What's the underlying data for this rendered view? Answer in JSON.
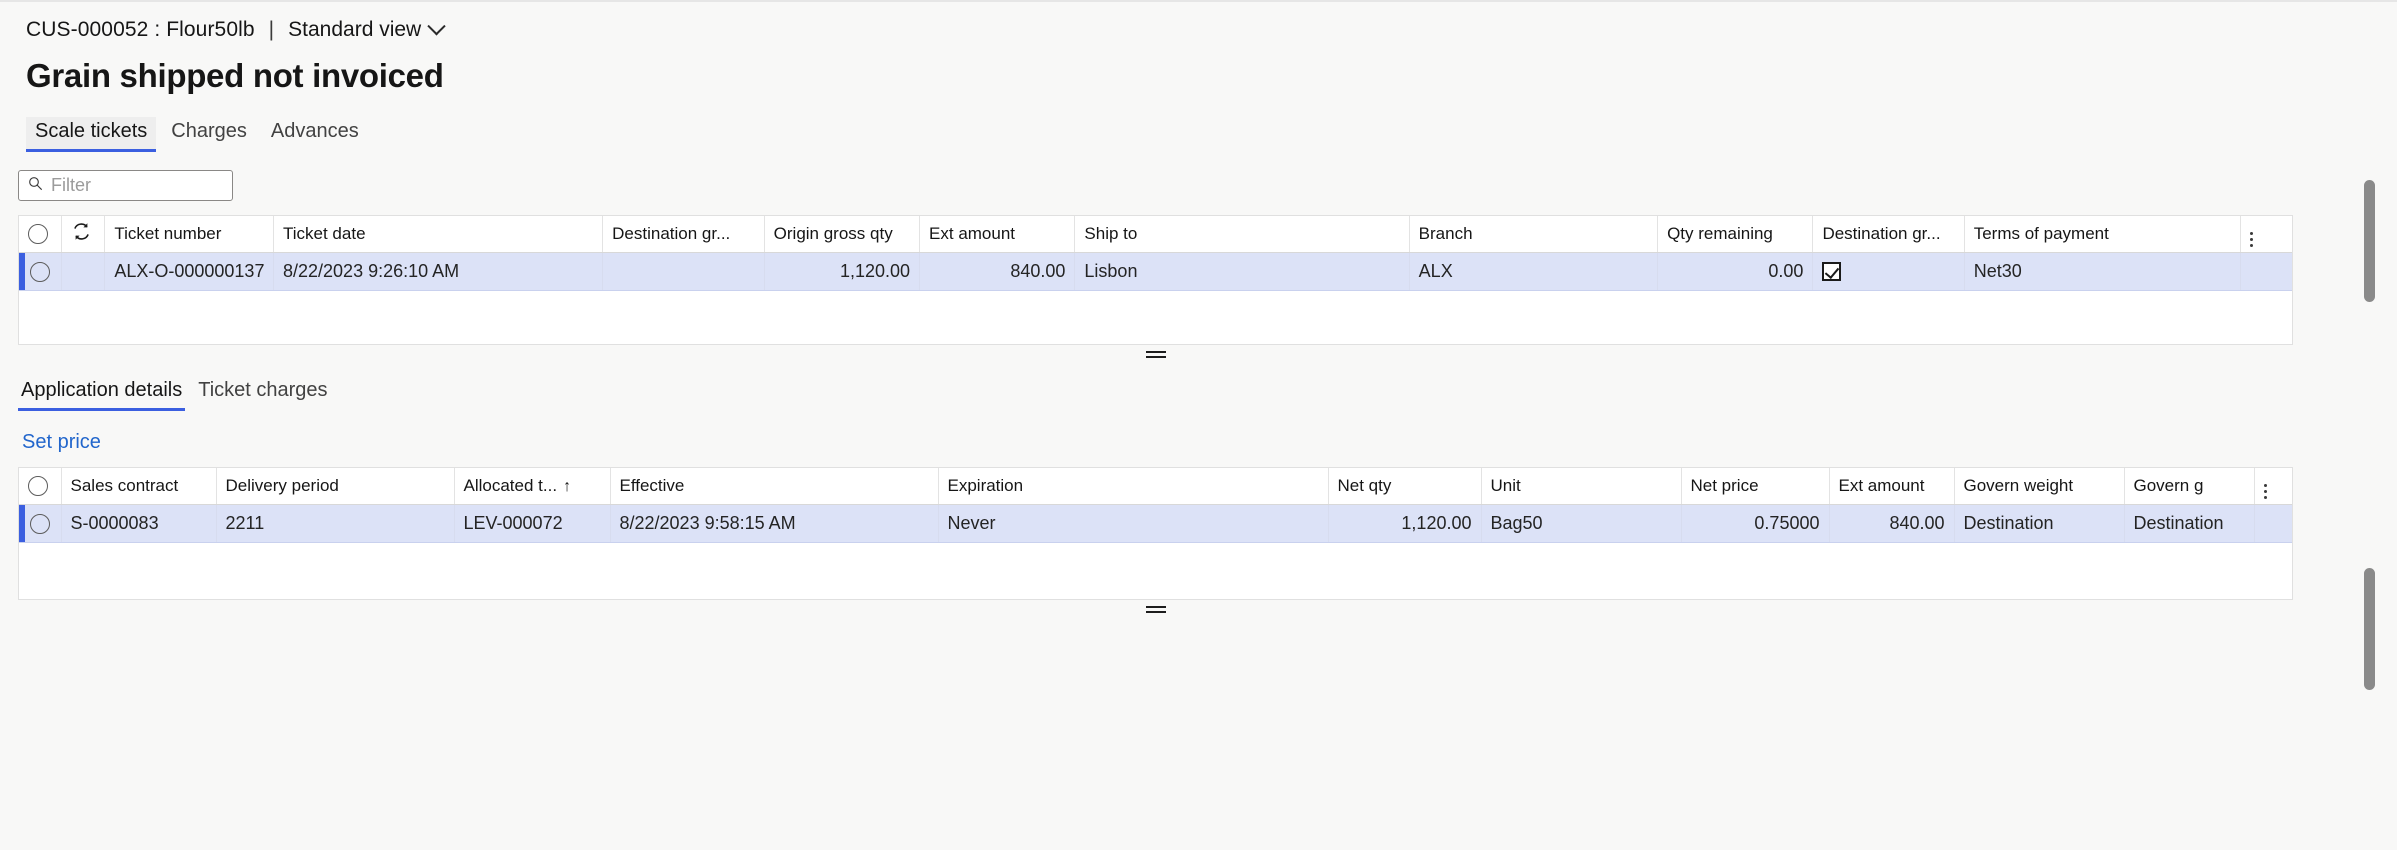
{
  "header": {
    "breadcrumb_record": "CUS-000052 : Flour50lb",
    "breadcrumb_separator": "|",
    "view_name": "Standard view",
    "page_title": "Grain shipped not invoiced"
  },
  "primary_tabs": [
    {
      "label": "Scale tickets",
      "active": true
    },
    {
      "label": "Charges",
      "active": false
    },
    {
      "label": "Advances",
      "active": false
    }
  ],
  "filter": {
    "placeholder": "Filter",
    "value": "",
    "icon": "search-icon"
  },
  "scale_tickets_grid": {
    "columns": [
      "Ticket number",
      "Ticket date",
      "Destination gr...",
      "Origin gross qty",
      "Ext amount",
      "Ship to",
      "Branch",
      "Qty remaining",
      "Destination gr...",
      "Terms of payment"
    ],
    "row": {
      "ticket_number": "ALX-O-000000137",
      "ticket_date": "8/22/2023 9:26:10 AM",
      "destination_gr_1": "",
      "origin_gross_qty": "1,120.00",
      "ext_amount": "840.00",
      "ship_to": "Lisbon",
      "branch": "ALX",
      "qty_remaining": "0.00",
      "destination_gr_2_checked": true,
      "terms_of_payment": "Net30"
    }
  },
  "secondary_tabs": [
    {
      "label": "Application details",
      "active": true
    },
    {
      "label": "Ticket charges",
      "active": false
    }
  ],
  "actions": {
    "set_price": "Set price"
  },
  "application_details_grid": {
    "columns": [
      "Sales contract",
      "Delivery period",
      "Allocated t...",
      "Effective",
      "Expiration",
      "Net qty",
      "Unit",
      "Net price",
      "Ext amount",
      "Govern weight",
      "Govern g"
    ],
    "sorted_column": "Allocated t...",
    "sort_direction": "↑",
    "row": {
      "sales_contract": "S-0000083",
      "delivery_period": "2211",
      "allocated_to": "LEV-000072",
      "effective": "8/22/2023 9:58:15 AM",
      "expiration": "Never",
      "net_qty": "1,120.00",
      "unit": "Bag50",
      "net_price": "0.75000",
      "ext_amount": "840.00",
      "govern_weight": "Destination",
      "govern_g": "Destination"
    }
  },
  "colors": {
    "accent": "#3b5fe0",
    "link": "#2266cc",
    "selected_row": "#dce2f7",
    "page_bg": "#f8f8f7"
  }
}
